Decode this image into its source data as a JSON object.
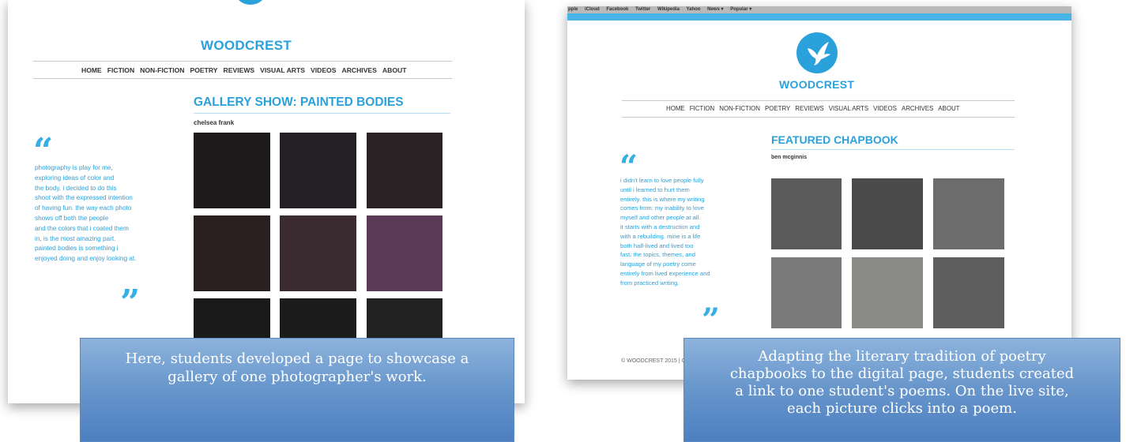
{
  "left_screenshot": {
    "brand": "WOODCREST",
    "nav": [
      "HOME",
      "FICTION",
      "NON-FICTION",
      "POETRY",
      "REVIEWS",
      "VISUAL ARTS",
      "VIDEOS",
      "ARCHIVES",
      "ABOUT"
    ],
    "heading": "GALLERY SHOW: PAINTED BODIES",
    "author": "chelsea frank",
    "quote_open": "“",
    "quote_close": "”",
    "quote_lines": [
      "photography is play for me,",
      "exploring ideas of color and",
      "the body. i decided to do this",
      "shoot with the expressed intention",
      "of having fun. the way each photo",
      "shows off both the people",
      "and the colors that i coated them",
      "in, is the most amazing part.",
      "painted bodies is something i",
      "enjoyed doing and enjoy looking at."
    ],
    "caption_lines": [
      "Here, students developed a page to showcase a",
      "gallery of one photographer's work."
    ]
  },
  "right_screenshot": {
    "bookmarks": [
      "pple",
      "iCloud",
      "Facebook",
      "Twitter",
      "Wikipedia",
      "Yahoo",
      "News ▾",
      "Popular ▾"
    ],
    "brand": "WOODCREST",
    "nav": [
      "HOME",
      "FICTION",
      "NON-FICTION",
      "POETRY",
      "REVIEWS",
      "VISUAL ARTS",
      "VIDEOS",
      "ARCHIVES",
      "ABOUT"
    ],
    "heading": "FEATURED CHAPBOOK",
    "author": "ben mcginnis",
    "quote_open": "“",
    "quote_close": "”",
    "quote_lines": [
      "i didn't learn to love people fully",
      "until i learned to hurt them",
      "entirely. this is where my writing",
      "comes from: my inability to love",
      "myself and other people at all.",
      "it starts with a destruction and",
      "with a rebuilding. mine is a life",
      "both half-lived and lived too",
      "fast. the topics, themes, and",
      "language of my poetry come",
      "entirely from lived experience and",
      "from practiced writing."
    ],
    "footer": "© WOODCREST 2015 | C",
    "caption_lines": [
      "Adapting the literary tradition of poetry",
      "chapbooks to the digital page, students created",
      "a link to one student's poems. On the live site,",
      "each picture clicks into a poem."
    ]
  },
  "colors": {
    "brand_blue": "#2aa1db",
    "accent_bar": "#49b4e6",
    "caption_gradient_top": "#8db3dc",
    "caption_gradient_bottom": "#4d7fc0"
  }
}
